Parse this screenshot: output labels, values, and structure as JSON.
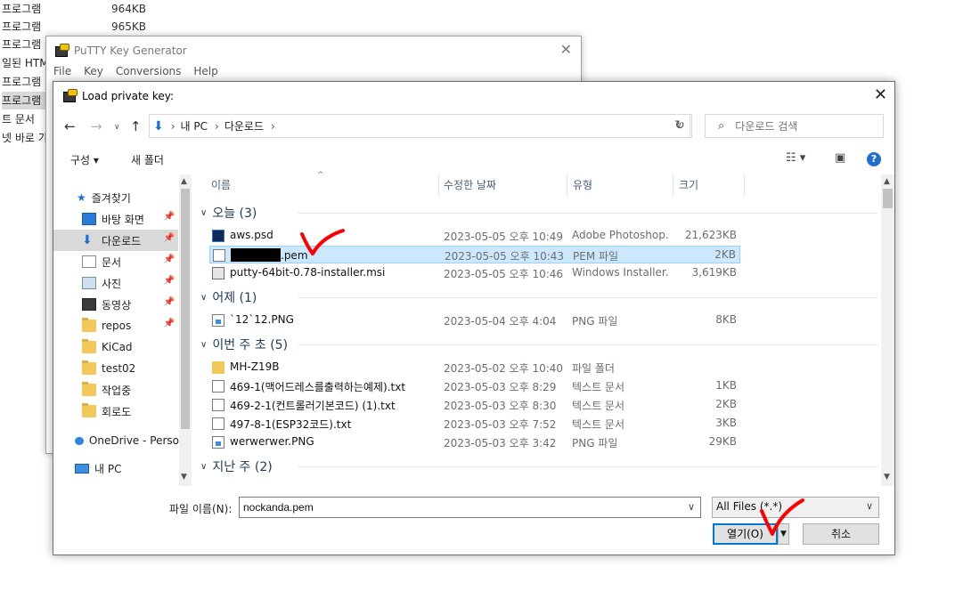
{
  "background_list": [
    {
      "name": "프로그램",
      "size": "964KB"
    },
    {
      "name": "프로그램",
      "size": "965KB"
    },
    {
      "name": "프로그램",
      "size": ""
    },
    {
      "name": "일된 HTM",
      "size": ""
    },
    {
      "name": "프로그램",
      "size": ""
    },
    {
      "name": "프로그램",
      "size": ""
    },
    {
      "name": "트 문서",
      "size": ""
    },
    {
      "name": "넷 바로 가",
      "size": ""
    }
  ],
  "putty": {
    "title": "PuTTY Key Generator",
    "menu": [
      "File",
      "Key",
      "Conversions",
      "Help"
    ]
  },
  "dialog": {
    "title": "Load private key:",
    "breadcrumb": [
      "내 PC",
      "다운로드"
    ],
    "search_placeholder": "다운로드 검색",
    "toolbar": {
      "organize": "구성 ▾",
      "new_folder": "새 폴더"
    },
    "nav": [
      {
        "label": "즐겨찾기",
        "icon": "star-icon",
        "pin": false
      },
      {
        "label": "바탕 화면",
        "icon": "desktop-icon",
        "pin": true
      },
      {
        "label": "다운로드",
        "icon": "download-icon",
        "pin": true,
        "selected": true
      },
      {
        "label": "문서",
        "icon": "document-icon",
        "pin": true
      },
      {
        "label": "사진",
        "icon": "picture-icon",
        "pin": true
      },
      {
        "label": "동영상",
        "icon": "video-icon",
        "pin": true
      },
      {
        "label": "repos",
        "icon": "folder-icon",
        "pin": true
      },
      {
        "label": "KiCad",
        "icon": "folder-icon",
        "pin": false
      },
      {
        "label": "test02",
        "icon": "folder-icon",
        "pin": false
      },
      {
        "label": "작업중",
        "icon": "folder-icon",
        "pin": false
      },
      {
        "label": "회로도",
        "icon": "folder-icon",
        "pin": false
      },
      {
        "label": "OneDrive - Perso",
        "icon": "onedrive-icon",
        "pin": false
      },
      {
        "label": "내 PC",
        "icon": "pc-icon",
        "pin": false
      }
    ],
    "columns": {
      "name": "이름",
      "date": "수정한 날짜",
      "type": "유형",
      "size": "크기"
    },
    "groups": [
      {
        "label": "오늘 (3)",
        "files": [
          {
            "name": "aws.psd",
            "date": "2023-05-05 오후 10:49",
            "type": "Adobe Photoshop...",
            "size": "21,623KB",
            "icon": "psd"
          },
          {
            "name": ".pem",
            "redacted": true,
            "date": "2023-05-05 오후 10:43",
            "type": "PEM 파일",
            "size": "2KB",
            "icon": "blank",
            "selected": true
          },
          {
            "name": "putty-64bit-0.78-installer.msi",
            "date": "2023-05-05 오후 10:46",
            "type": "Windows Installer...",
            "size": "3,619KB",
            "icon": "msi"
          }
        ]
      },
      {
        "label": "어제 (1)",
        "files": [
          {
            "name": "`12`12.PNG",
            "date": "2023-05-04 오후 4:04",
            "type": "PNG 파일",
            "size": "8KB",
            "icon": "png"
          }
        ]
      },
      {
        "label": "이번 주 초 (5)",
        "files": [
          {
            "name": "MH-Z19B",
            "date": "2023-05-02 오후 10:40",
            "type": "파일 폴더",
            "size": "",
            "icon": "fold"
          },
          {
            "name": "469-1(맥어드레스를출력하는예제).txt",
            "date": "2023-05-03 오후 8:29",
            "type": "텍스트 문서",
            "size": "1KB",
            "icon": "txt"
          },
          {
            "name": "469-2-1(컨트롤러기본코드) (1).txt",
            "date": "2023-05-03 오후 8:30",
            "type": "텍스트 문서",
            "size": "2KB",
            "icon": "txt"
          },
          {
            "name": "497-8-1(ESP32코드).txt",
            "date": "2023-05-03 오후 7:52",
            "type": "텍스트 문서",
            "size": "3KB",
            "icon": "txt"
          },
          {
            "name": "werwerwer.PNG",
            "date": "2023-05-03 오후 3:42",
            "type": "PNG 파일",
            "size": "29KB",
            "icon": "png"
          }
        ]
      },
      {
        "label": "지난 주 (2)",
        "files": []
      }
    ],
    "filename_label": "파일 이름(N):",
    "filename_value": "nockanda.pem",
    "filter": "All Files (*.*)",
    "open_label": "열기(O)",
    "cancel_label": "취소"
  },
  "colors": {
    "accent": "#0078d7",
    "selection": "#cce8ff",
    "group_text": "#1e395b",
    "check_mark": "#ff0000"
  }
}
